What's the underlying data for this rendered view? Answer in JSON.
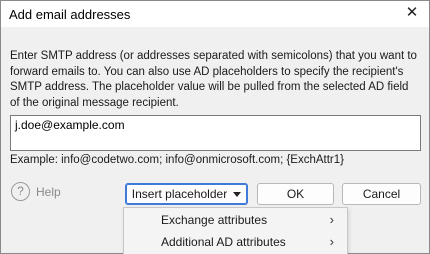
{
  "window": {
    "title": "Add email addresses",
    "close_glyph": "✕"
  },
  "description": "Enter SMTP address (or addresses separated with semicolons) that you want to forward emails to. You can also use AD placeholders to specify the recipient's SMTP address. The placeholder value will be pulled from the selected AD field of the original message recipient.",
  "email_input": {
    "value": "j.doe@example.com"
  },
  "example": "Example: info@codetwo.com; info@onmicrosoft.com; {ExchAttr1}",
  "help": {
    "icon_glyph": "?",
    "label": "Help"
  },
  "buttons": {
    "insert_placeholder": "Insert placeholder",
    "ok": "OK",
    "cancel": "Cancel"
  },
  "placeholder_menu": {
    "items": [
      {
        "label": "Exchange attributes",
        "arrow": "›"
      },
      {
        "label": "Additional AD attributes",
        "arrow": "›"
      }
    ]
  },
  "colors": {
    "focus_accent": "#3f7ad9"
  }
}
